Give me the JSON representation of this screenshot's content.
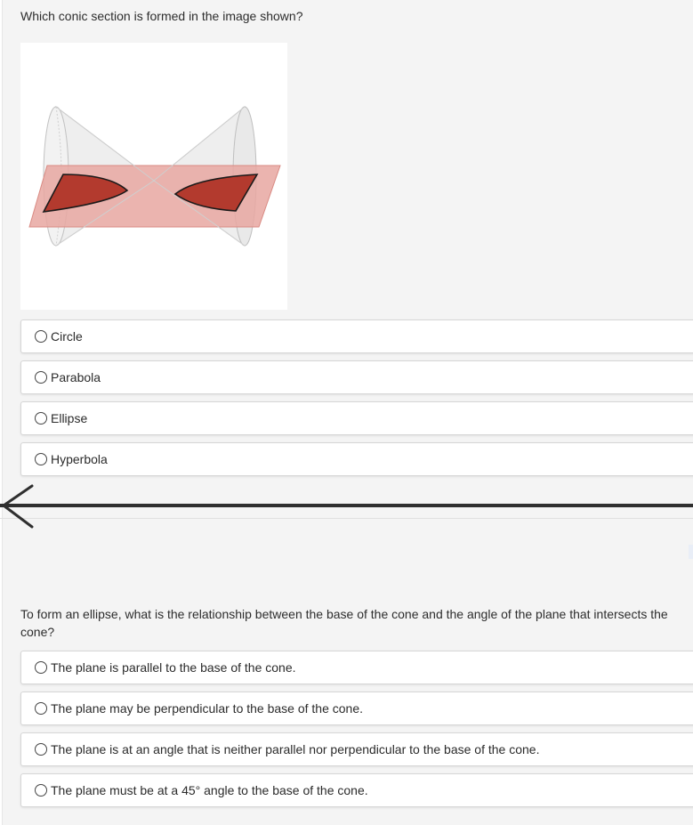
{
  "question1": {
    "text": "Which conic section is formed in the image shown?",
    "choices": [
      "Circle",
      "Parabola",
      "Ellipse",
      "Hyperbola"
    ]
  },
  "question2": {
    "text": "To form an ellipse, what is the relationship between the base of the cone and the angle of the plane that intersects the cone?",
    "choices": [
      "The plane is parallel to the base of the cone.",
      "The plane may be perpendicular to the base of the cone.",
      "The plane is at an angle that is neither parallel nor perpendicular to the base of the cone.",
      "The plane must be at a 45° angle to the base of the cone."
    ]
  },
  "colors": {
    "page_bg": "#f4f4f4",
    "plane_fill": "#e8a7a1",
    "section_fill": "#b33a2e",
    "divider": "#2f2f2f"
  },
  "icons": {
    "back": "chevron-left-icon"
  }
}
